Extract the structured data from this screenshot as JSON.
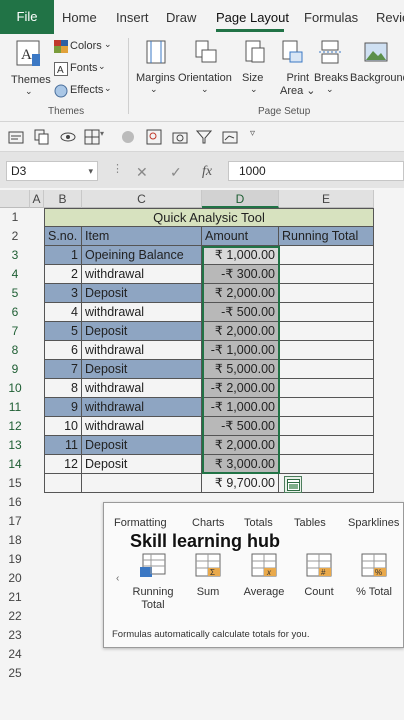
{
  "ribbon": {
    "tabs": [
      "File",
      "Home",
      "Insert",
      "Draw",
      "Page Layout",
      "Formulas",
      "Revie"
    ],
    "themes": {
      "themes_label": "Themes",
      "colors_label": "Colors",
      "fonts_label": "Fonts",
      "effects_label": "Effects",
      "group_label": "Themes"
    },
    "page_setup": {
      "margins": "Margins",
      "orientation": "Orientation",
      "size": "Size",
      "print_area": "Print Area",
      "breaks": "Breaks",
      "background": "Background",
      "group_label": "Page Setup"
    }
  },
  "formula_bar": {
    "name_box": "D3",
    "cancel": "✕",
    "enter": "✓",
    "fx": "fx",
    "value": "1000"
  },
  "grid": {
    "columns": [
      "A",
      "B",
      "C",
      "D",
      "E"
    ],
    "rows": [
      "1",
      "2",
      "3",
      "4",
      "5",
      "6",
      "7",
      "8",
      "9",
      "10",
      "11",
      "12",
      "13",
      "14",
      "15",
      "16",
      "17",
      "18",
      "19",
      "20",
      "21",
      "22",
      "23",
      "24",
      "25"
    ],
    "title": "Quick Analysic Tool",
    "headers": {
      "sno": "S.no.",
      "item": "Item",
      "amount": "Amount",
      "running": "Running Total"
    },
    "data": [
      {
        "sno": "1",
        "item": "Opeining Balance",
        "amount": "₹ 1,000.00"
      },
      {
        "sno": "2",
        "item": "withdrawal",
        "amount": "-₹ 300.00"
      },
      {
        "sno": "3",
        "item": "Deposit",
        "amount": "₹ 2,000.00"
      },
      {
        "sno": "4",
        "item": "withdrawal",
        "amount": "-₹ 500.00"
      },
      {
        "sno": "5",
        "item": "Deposit",
        "amount": "₹ 2,000.00"
      },
      {
        "sno": "6",
        "item": "withdrawal",
        "amount": "-₹ 1,000.00"
      },
      {
        "sno": "7",
        "item": "Deposit",
        "amount": "₹ 5,000.00"
      },
      {
        "sno": "8",
        "item": "withdrawal",
        "amount": "-₹ 2,000.00"
      },
      {
        "sno": "9",
        "item": "withdrawal",
        "amount": "-₹ 1,000.00"
      },
      {
        "sno": "10",
        "item": "withdrawal",
        "amount": "-₹ 500.00"
      },
      {
        "sno": "11",
        "item": "Deposit",
        "amount": "₹ 2,000.00"
      },
      {
        "sno": "12",
        "item": "Deposit",
        "amount": "₹ 3,000.00"
      }
    ],
    "total": "₹ 9,700.00"
  },
  "quick_analysis": {
    "tabs": [
      "Formatting",
      "Charts",
      "Totals",
      "Tables",
      "Sparklines"
    ],
    "overlay_text": "Skill learning hub",
    "items": [
      "Running Total",
      "Sum",
      "Average",
      "Count",
      "% Total"
    ],
    "description": "Formulas automatically calculate totals for you."
  },
  "colors": {
    "accent": "#217346",
    "row_highlight": "#8ea5c2",
    "title_fill": "#d7e2bf"
  }
}
